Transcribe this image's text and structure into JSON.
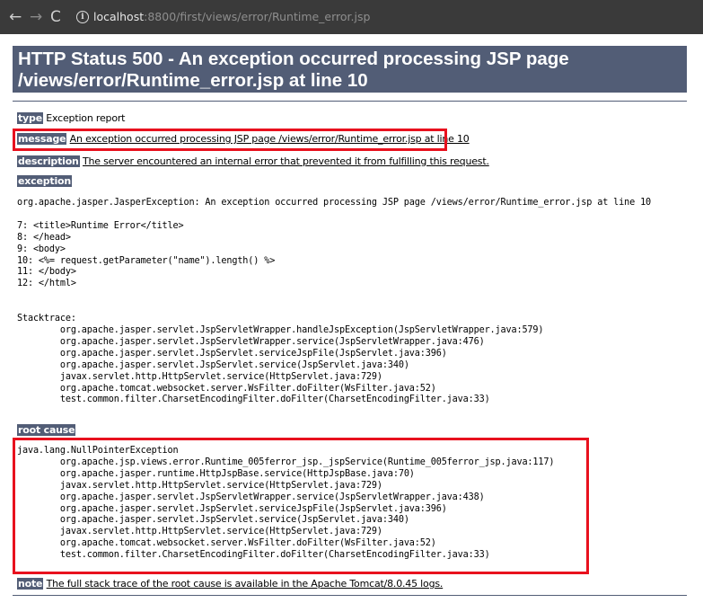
{
  "browser": {
    "back_glyph": "←",
    "forward_glyph": "→",
    "reload_glyph": "C",
    "url_host": "localhost",
    "url_path": ":8800/first/views/error/Runtime_error.jsp"
  },
  "page": {
    "title": "HTTP Status 500 - An exception occurred processing JSP page /views/error/Runtime_error.jsp at line 10",
    "type_label": "type",
    "type_value": "Exception report",
    "message_label": "message",
    "message_value": "An exception occurred processing JSP page /views/error/Runtime_error.jsp at line 10",
    "description_label": "description",
    "description_value": "The server encountered an internal error that prevented it from fulfilling this request.",
    "exception_label": "exception",
    "exception_text": "org.apache.jasper.JasperException: An exception occurred processing JSP page /views/error/Runtime_error.jsp at line 10\n\n7: <title>Runtime Error</title>\n8: </head>\n9: <body>\n10: <%= request.getParameter(\"name\").length() %>\n11: </body>\n12: </html>\n\n\nStacktrace:\n\torg.apache.jasper.servlet.JspServletWrapper.handleJspException(JspServletWrapper.java:579)\n\torg.apache.jasper.servlet.JspServletWrapper.service(JspServletWrapper.java:476)\n\torg.apache.jasper.servlet.JspServlet.serviceJspFile(JspServlet.java:396)\n\torg.apache.jasper.servlet.JspServlet.service(JspServlet.java:340)\n\tjavax.servlet.http.HttpServlet.service(HttpServlet.java:729)\n\torg.apache.tomcat.websocket.server.WsFilter.doFilter(WsFilter.java:52)\n\ttest.common.filter.CharsetEncodingFilter.doFilter(CharsetEncodingFilter.java:33)",
    "root_cause_label": "root cause",
    "root_cause_text": "java.lang.NullPointerException\n\torg.apache.jsp.views.error.Runtime_005ferror_jsp._jspService(Runtime_005ferror_jsp.java:117)\n\torg.apache.jasper.runtime.HttpJspBase.service(HttpJspBase.java:70)\n\tjavax.servlet.http.HttpServlet.service(HttpServlet.java:729)\n\torg.apache.jasper.servlet.JspServletWrapper.service(JspServletWrapper.java:438)\n\torg.apache.jasper.servlet.JspServlet.serviceJspFile(JspServlet.java:396)\n\torg.apache.jasper.servlet.JspServlet.service(JspServlet.java:340)\n\tjavax.servlet.http.HttpServlet.service(HttpServlet.java:729)\n\torg.apache.tomcat.websocket.server.WsFilter.doFilter(WsFilter.java:52)\n\ttest.common.filter.CharsetEncodingFilter.doFilter(CharsetEncodingFilter.java:33)",
    "note_label": "note",
    "note_value": "The full stack trace of the root cause is available in the Apache Tomcat/8.0.45 logs."
  },
  "colors": {
    "header_bg": "#525d76",
    "highlight_box": "#e8111e",
    "browser_bar": "#3a3a3a"
  },
  "icons": {
    "info": "info-icon"
  }
}
